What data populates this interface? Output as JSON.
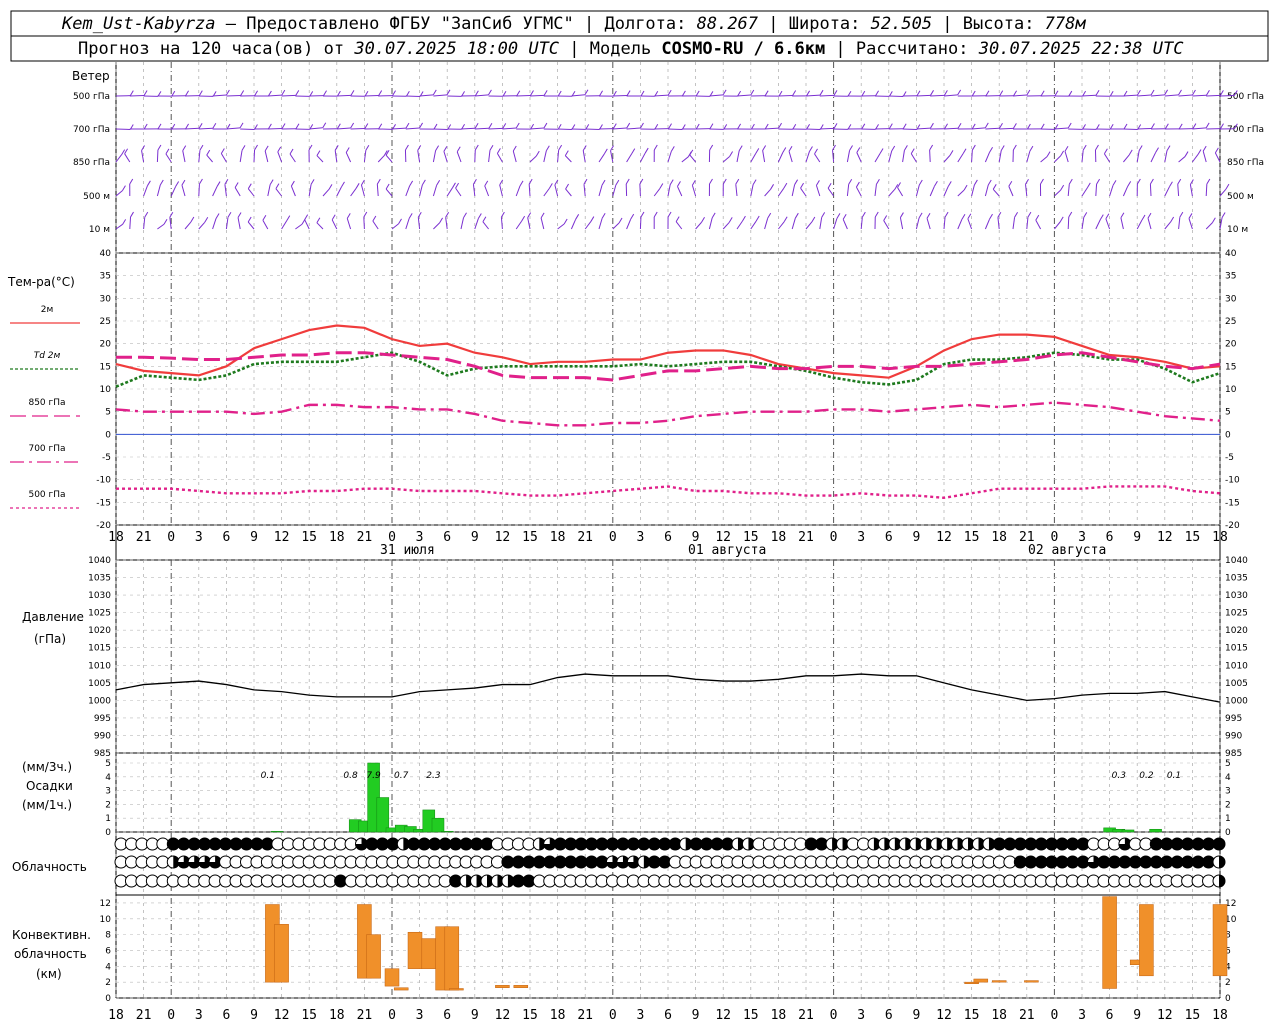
{
  "header": {
    "line1_station": "Kem_Ust-Kabyrza",
    "line1_sep": " — ",
    "line1_provider": "Предоставлено ФГБУ \"ЗапСиб УГМС\"",
    "line1_lon_label": "Долгота: ",
    "line1_lon": "88.267",
    "line1_lat_label": "Широта: ",
    "line1_lat": "52.505",
    "line1_alt_label": "Высота: ",
    "line1_alt": "778м",
    "line2_forecast": "Прогноз на 120 часа(ов) от ",
    "line2_start": "30.07.2025 18:00 UTC",
    "line2_model_label": "Модель ",
    "line2_model": "COSMO-RU / 6.6км",
    "line2_calc_label": "Рассчитано: ",
    "line2_calc": "30.07.2025 22:38 UTC"
  },
  "panels": {
    "wind": {
      "title": "Ветер",
      "levels": [
        "500 гПа",
        "700 гПа",
        "850 гПа",
        "500 м",
        "10 м"
      ]
    },
    "temperature": {
      "title": "Тем-ра(°C)",
      "legend": [
        "2м",
        "Td 2м",
        "850 гПа",
        "700 гПа",
        "500 гПа"
      ],
      "colors": [
        "#f03c3c",
        "#1e7a1e",
        "#e0208a",
        "#e0208a",
        "#e0208a"
      ]
    },
    "pressure": {
      "title_line1": "Давление",
      "title_line2": "(гПа)"
    },
    "precip": {
      "title_line1": "(мм/3ч.)",
      "title_line2": "Осадки",
      "title_line3": "(мм/1ч.)",
      "labels": [
        "0.1",
        "0.8",
        "7.9",
        "0.7",
        "2.3",
        "0.3",
        "0.2",
        "0.1"
      ]
    },
    "clouds": {
      "title": "Облачность"
    },
    "convective": {
      "title_line1": "Конвективн.",
      "title_line2": "облачность",
      "title_line3": "(км)"
    }
  },
  "x_axis": {
    "hour_labels": [
      "18",
      "21",
      "0",
      "3",
      "6",
      "9",
      "12",
      "15",
      "18",
      "21",
      "0",
      "3",
      "6",
      "9",
      "12",
      "15",
      "18",
      "21",
      "0",
      "3",
      "6",
      "9",
      "12",
      "15",
      "18",
      "21",
      "0"
    ],
    "day_labels": [
      "31 июля",
      "01 августа",
      "02 августа"
    ]
  },
  "chart_data": [
    {
      "type": "line",
      "title": "Тем-ра(°C)",
      "x_hours_from_start": [
        0,
        3,
        6,
        9,
        12,
        15,
        18,
        21,
        24,
        27,
        30,
        33,
        36,
        39,
        42,
        45,
        48,
        51,
        54,
        57,
        60,
        63,
        66,
        69,
        72,
        75,
        78,
        81,
        84,
        87,
        90,
        93,
        96,
        99,
        102,
        105,
        108,
        111,
        114,
        117,
        120
      ],
      "ylim": [
        -20,
        40
      ],
      "yticks": [
        -20,
        -15,
        -10,
        -5,
        0,
        5,
        10,
        15,
        20,
        25,
        30,
        35,
        40
      ],
      "series": [
        {
          "name": "2м",
          "color": "#f03c3c",
          "values": [
            15.5,
            14,
            13.5,
            13,
            15,
            19,
            21,
            23,
            24,
            23.5,
            21,
            19.5,
            20,
            18,
            17,
            15.5,
            16,
            16,
            16.5,
            16.5,
            18,
            18.5,
            18.5,
            17.5,
            15.5,
            14.5,
            13.5,
            13,
            12.5,
            15,
            18.5,
            21,
            22,
            22,
            21.5,
            19.5,
            17.5,
            17,
            16,
            14.5,
            15
          ]
        },
        {
          "name": "Td 2м",
          "color": "#1e7a1e",
          "values": [
            10.5,
            13,
            12.5,
            12,
            13,
            15.5,
            16,
            16,
            16,
            17,
            18,
            16,
            13,
            14.5,
            15,
            15,
            15,
            15,
            15,
            15.5,
            15,
            15.5,
            16,
            16,
            15,
            14,
            12.5,
            11.5,
            11,
            12,
            15.5,
            16.5,
            16.5,
            17,
            18,
            17.5,
            16.5,
            16.5,
            14.5,
            11.5,
            13.5
          ]
        },
        {
          "name": "850 гПа",
          "color": "#e0208a",
          "values": [
            17,
            17,
            16.8,
            16.5,
            16.5,
            17,
            17.5,
            17.5,
            18,
            18,
            17.5,
            17,
            16.5,
            15,
            13,
            12.5,
            12.5,
            12.5,
            12,
            13,
            14,
            14,
            14.5,
            15,
            14.5,
            14.5,
            15,
            15,
            14.5,
            15,
            15,
            15.5,
            16,
            16.5,
            17.5,
            18,
            17,
            16,
            15,
            14.5,
            15.5
          ]
        },
        {
          "name": "700 гПа",
          "color": "#e0208a",
          "values": [
            5.5,
            5,
            5,
            5,
            5,
            4.5,
            5,
            6.5,
            6.5,
            6,
            6,
            5.5,
            5.5,
            4.5,
            3,
            2.5,
            2,
            2,
            2.5,
            2.5,
            3,
            4,
            4.5,
            5,
            5,
            5,
            5.5,
            5.5,
            5,
            5.5,
            6,
            6.5,
            6,
            6.5,
            7,
            6.5,
            6,
            5,
            4,
            3.5,
            3
          ]
        },
        {
          "name": "500 гПа",
          "color": "#e0208a",
          "values": [
            -12,
            -12,
            -12,
            -12.5,
            -13,
            -13,
            -13,
            -12.5,
            -12.5,
            -12,
            -12,
            -12.5,
            -12.5,
            -12.5,
            -13,
            -13.5,
            -13.5,
            -13,
            -12.5,
            -12,
            -11.5,
            -12.5,
            -12.5,
            -13,
            -13,
            -13.5,
            -13.5,
            -13,
            -13.5,
            -13.5,
            -14,
            -13,
            -12,
            -12,
            -12,
            -12,
            -11.5,
            -11.5,
            -11.5,
            -12.5,
            -13
          ]
        }
      ]
    },
    {
      "type": "line",
      "title": "Давление (гПа)",
      "x_hours_from_start": [
        0,
        3,
        6,
        9,
        12,
        15,
        18,
        21,
        24,
        27,
        30,
        33,
        36,
        39,
        42,
        45,
        48,
        51,
        54,
        57,
        60,
        63,
        66,
        69,
        72,
        75,
        78,
        81,
        84,
        87,
        90,
        93,
        96,
        99,
        102,
        105,
        108,
        111,
        114,
        117,
        120
      ],
      "ylim": [
        985,
        1040
      ],
      "yticks": [
        985,
        990,
        995,
        1000,
        1005,
        1010,
        1015,
        1020,
        1025,
        1030,
        1035,
        1040
      ],
      "series": [
        {
          "name": "",
          "color": "#000000",
          "values": [
            1003,
            1004.5,
            1005,
            1005.5,
            1004.5,
            1003,
            1002.5,
            1001.5,
            1001,
            1001,
            1001,
            1002.5,
            1003,
            1003.5,
            1004.5,
            1004.5,
            1006.5,
            1007.5,
            1007,
            1007,
            1007,
            1006,
            1005.5,
            1005.5,
            1006,
            1007,
            1007,
            1007.5,
            1007,
            1007,
            1005,
            1003,
            1001.5,
            1000,
            1000.5,
            1001.5,
            1002,
            1002,
            1002.5,
            1001,
            999.5
          ]
        }
      ]
    },
    {
      "type": "bar",
      "title": "Осадки (мм/1ч.)",
      "ylim": [
        0,
        5
      ],
      "yticks": [
        0,
        1,
        2,
        3,
        4,
        5
      ],
      "x_hours_from_start": [
        17.5,
        26,
        27,
        28,
        29,
        30,
        31,
        32,
        33,
        34,
        35,
        36,
        108,
        109,
        110,
        113
      ],
      "values": [
        0.05,
        0.9,
        0.8,
        5,
        2.5,
        0.3,
        0.5,
        0.4,
        0.2,
        1.6,
        1.0,
        0.05,
        0.3,
        0.2,
        0.15,
        0.2
      ],
      "labels_3h": [
        {
          "x": 16.5,
          "text": "0.1"
        },
        {
          "x": 25.5,
          "text": "0.8"
        },
        {
          "x": 28,
          "text": "7.9"
        },
        {
          "x": 31,
          "text": "0.7"
        },
        {
          "x": 34.5,
          "text": "2.3"
        },
        {
          "x": 109,
          "text": "0.3"
        },
        {
          "x": 112,
          "text": "0.2"
        },
        {
          "x": 115,
          "text": "0.1"
        }
      ]
    },
    {
      "type": "bar",
      "title": "Конвективн. облачность (км)",
      "ylim": [
        0,
        13
      ],
      "yticks": [
        0,
        2,
        4,
        6,
        8,
        10,
        12
      ],
      "bars": [
        {
          "x": 17,
          "bottom": 2,
          "top": 11.8
        },
        {
          "x": 18,
          "bottom": 2,
          "top": 9.3
        },
        {
          "x": 27,
          "bottom": 2.5,
          "top": 11.8
        },
        {
          "x": 28,
          "bottom": 2.5,
          "top": 8
        },
        {
          "x": 30,
          "bottom": 1.5,
          "top": 3.7
        },
        {
          "x": 31,
          "bottom": 1,
          "top": 1.3
        },
        {
          "x": 32.5,
          "bottom": 3.7,
          "top": 8.3
        },
        {
          "x": 34,
          "bottom": 3.7,
          "top": 7.5
        },
        {
          "x": 35.5,
          "bottom": 1,
          "top": 9
        },
        {
          "x": 36.5,
          "bottom": 1,
          "top": 9
        },
        {
          "x": 37,
          "bottom": 1,
          "top": 1.2
        },
        {
          "x": 42,
          "bottom": 1.3,
          "top": 1.6
        },
        {
          "x": 44,
          "bottom": 1.3,
          "top": 1.6
        },
        {
          "x": 93,
          "bottom": 1.8,
          "top": 2
        },
        {
          "x": 94,
          "bottom": 2,
          "top": 2.4
        },
        {
          "x": 96,
          "bottom": 2,
          "top": 2.2
        },
        {
          "x": 99.5,
          "bottom": 2,
          "top": 2.2
        },
        {
          "x": 108,
          "bottom": 1.2,
          "top": 12.8
        },
        {
          "x": 111,
          "bottom": 4.2,
          "top": 4.8
        },
        {
          "x": 112,
          "bottom": 2.8,
          "top": 11.8
        },
        {
          "x": 120,
          "bottom": 2.8,
          "top": 11.8
        }
      ]
    }
  ],
  "cloud_rows": {
    "row1": "0000011111111110000000031112111111110000231111111111112111122000001122002222222222221111111110003001111111",
    "row2": "0000023333000000000000000000000000000111111111133321100000000000000000000000000000000011111113111111111112",
    "row3": "0000000000000000000001000000000012222211000000000000000000000000000000000000000000000000000000000000000002"
  }
}
